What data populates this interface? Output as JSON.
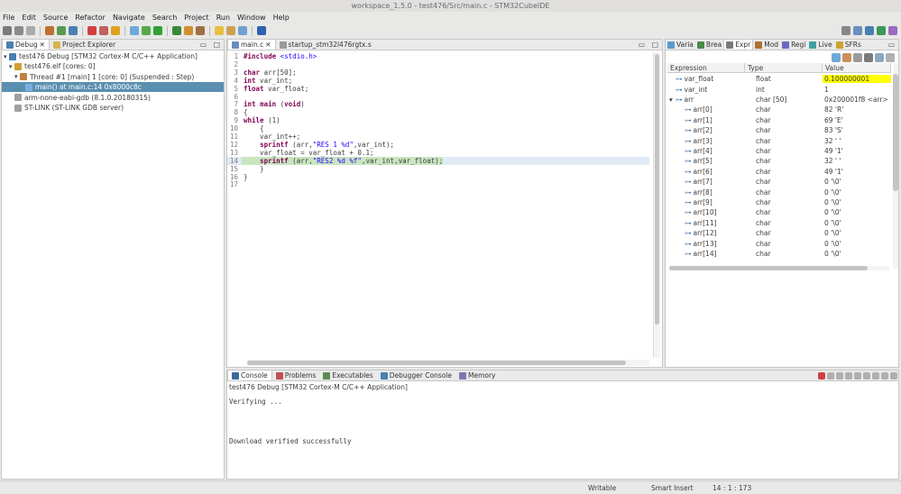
{
  "window": {
    "title": "workspace_1.5.0 - test476/Src/main.c - STM32CubeIDE"
  },
  "menu": [
    "File",
    "Edit",
    "Source",
    "Refactor",
    "Navigate",
    "Search",
    "Project",
    "Run",
    "Window",
    "Help"
  ],
  "debug_panel": {
    "tabs": [
      {
        "label": "Debug"
      },
      {
        "label": "Project Explorer"
      }
    ],
    "tree": [
      {
        "label": "test476 Debug [STM32 Cortex-M C/C++ Application]",
        "indent": 0,
        "icon": "debug-config-icon"
      },
      {
        "label": "test476.elf [cores: 0]",
        "indent": 1,
        "icon": "elf-icon"
      },
      {
        "label": "Thread #1 [main] 1 [core: 0] (Suspended : Step)",
        "indent": 2,
        "icon": "thread-icon"
      },
      {
        "label": "main() at main.c:14 0x8000c8c",
        "indent": 3,
        "icon": "stack-frame-icon",
        "selected": true
      },
      {
        "label": "arm-none-eabi-gdb (8.1.0.20180315)",
        "indent": 1,
        "icon": "gdb-icon"
      },
      {
        "label": "ST-LINK (ST-LINK GDB server)",
        "indent": 1,
        "icon": "stlink-icon"
      }
    ]
  },
  "editor": {
    "tabs": [
      {
        "label": "main.c"
      },
      {
        "label": "startup_stm32l476rgtx.s"
      }
    ],
    "current_line": 14,
    "lines": [
      {
        "n": "1",
        "tokens": [
          {
            "t": "#include ",
            "c": "kw"
          },
          {
            "t": "<stdio.h>",
            "c": "str"
          }
        ]
      },
      {
        "n": "2",
        "tokens": []
      },
      {
        "n": "3",
        "tokens": [
          {
            "t": "char",
            "c": "kw"
          },
          {
            "t": " arr[50];",
            "c": ""
          }
        ]
      },
      {
        "n": "4",
        "tokens": [
          {
            "t": "int",
            "c": "kw"
          },
          {
            "t": " var_int;",
            "c": ""
          }
        ]
      },
      {
        "n": "5",
        "tokens": [
          {
            "t": "float",
            "c": "kw"
          },
          {
            "t": " var_float;",
            "c": ""
          }
        ]
      },
      {
        "n": "6",
        "tokens": []
      },
      {
        "n": "7",
        "tokens": [
          {
            "t": "int",
            "c": "kw"
          },
          {
            "t": " ",
            "c": ""
          },
          {
            "t": "main",
            "c": "kw"
          },
          {
            "t": " (",
            "c": ""
          },
          {
            "t": "void",
            "c": "kw"
          },
          {
            "t": ")",
            "c": ""
          }
        ]
      },
      {
        "n": "8",
        "tokens": [
          {
            "t": "{",
            "c": ""
          }
        ]
      },
      {
        "n": "9",
        "tokens": [
          {
            "t": "while",
            "c": "kw"
          },
          {
            "t": " (1)",
            "c": ""
          }
        ]
      },
      {
        "n": "10",
        "tokens": [
          {
            "t": "    {",
            "c": ""
          }
        ]
      },
      {
        "n": "11",
        "tokens": [
          {
            "t": "    var_int++;",
            "c": ""
          }
        ]
      },
      {
        "n": "12",
        "tokens": [
          {
            "t": "    ",
            "c": ""
          },
          {
            "t": "sprintf",
            "c": "kw"
          },
          {
            "t": " (arr,",
            "c": ""
          },
          {
            "t": "\"RES 1 %d\"",
            "c": "str"
          },
          {
            "t": ",var_int);",
            "c": ""
          }
        ]
      },
      {
        "n": "13",
        "tokens": [
          {
            "t": "    var_float = var_float + 0.1;",
            "c": ""
          }
        ]
      },
      {
        "n": "14",
        "tokens": [
          {
            "t": "    ",
            "c": ""
          },
          {
            "t": "sprintf",
            "c": "kw"
          },
          {
            "t": " (arr,",
            "c": ""
          },
          {
            "t": "\"RES2 %d %f\"",
            "c": "str"
          },
          {
            "t": ",var_int,var_float);",
            "c": ""
          }
        ]
      },
      {
        "n": "15",
        "tokens": [
          {
            "t": "    }",
            "c": ""
          }
        ]
      },
      {
        "n": "16",
        "tokens": [
          {
            "t": "}",
            "c": ""
          }
        ]
      },
      {
        "n": "17",
        "tokens": []
      }
    ]
  },
  "expressions_panel": {
    "tabs": [
      {
        "label": "Varia"
      },
      {
        "label": "Brea"
      },
      {
        "label": "Expr"
      },
      {
        "label": "Mod"
      },
      {
        "label": "Regi"
      },
      {
        "label": "Live"
      },
      {
        "label": "SFRs"
      }
    ],
    "columns": [
      "Expression",
      "Type",
      "Value"
    ],
    "rows": [
      {
        "expr": "var_float",
        "type": "float",
        "value": "0.100000001",
        "highlight": true,
        "indent": 0
      },
      {
        "expr": "var_int",
        "type": "int",
        "value": "1",
        "indent": 0
      },
      {
        "expr": "arr",
        "type": "char [50]",
        "value": "0x200001f8 <arr>",
        "indent": 0,
        "expanded": true
      },
      {
        "expr": "arr[0]",
        "type": "char",
        "value": "82 'R'",
        "indent": 1
      },
      {
        "expr": "arr[1]",
        "type": "char",
        "value": "69 'E'",
        "indent": 1
      },
      {
        "expr": "arr[2]",
        "type": "char",
        "value": "83 'S'",
        "indent": 1
      },
      {
        "expr": "arr[3]",
        "type": "char",
        "value": "32 ' '",
        "indent": 1
      },
      {
        "expr": "arr[4]",
        "type": "char",
        "value": "49 '1'",
        "indent": 1
      },
      {
        "expr": "arr[5]",
        "type": "char",
        "value": "32 ' '",
        "indent": 1
      },
      {
        "expr": "arr[6]",
        "type": "char",
        "value": "49 '1'",
        "indent": 1
      },
      {
        "expr": "arr[7]",
        "type": "char",
        "value": "0 '\\0'",
        "indent": 1
      },
      {
        "expr": "arr[8]",
        "type": "char",
        "value": "0 '\\0'",
        "indent": 1
      },
      {
        "expr": "arr[9]",
        "type": "char",
        "value": "0 '\\0'",
        "indent": 1
      },
      {
        "expr": "arr[10]",
        "type": "char",
        "value": "0 '\\0'",
        "indent": 1
      },
      {
        "expr": "arr[11]",
        "type": "char",
        "value": "0 '\\0'",
        "indent": 1
      },
      {
        "expr": "arr[12]",
        "type": "char",
        "value": "0 '\\0'",
        "indent": 1
      },
      {
        "expr": "arr[13]",
        "type": "char",
        "value": "0 '\\0'",
        "indent": 1
      },
      {
        "expr": "arr[14]",
        "type": "char",
        "value": "0 '\\0'",
        "indent": 1
      }
    ]
  },
  "console_panel": {
    "tabs": [
      {
        "label": "Console"
      },
      {
        "label": "Problems"
      },
      {
        "label": "Executables"
      },
      {
        "label": "Debugger Console"
      },
      {
        "label": "Memory"
      }
    ],
    "header": "test476 Debug [STM32 Cortex-M C/C++ Application]",
    "lines": [
      "Verifying ...",
      "",
      "",
      "",
      "Download verified successfully"
    ]
  },
  "status": {
    "writable": "Writable",
    "insert_mode": "Smart Insert",
    "position": "14 : 1 : 173"
  },
  "colors": {
    "selection": "#5b8fb0",
    "current_line": "#dfeaf5",
    "highlight_value": "#ffff00",
    "accent": "#3874a5"
  }
}
